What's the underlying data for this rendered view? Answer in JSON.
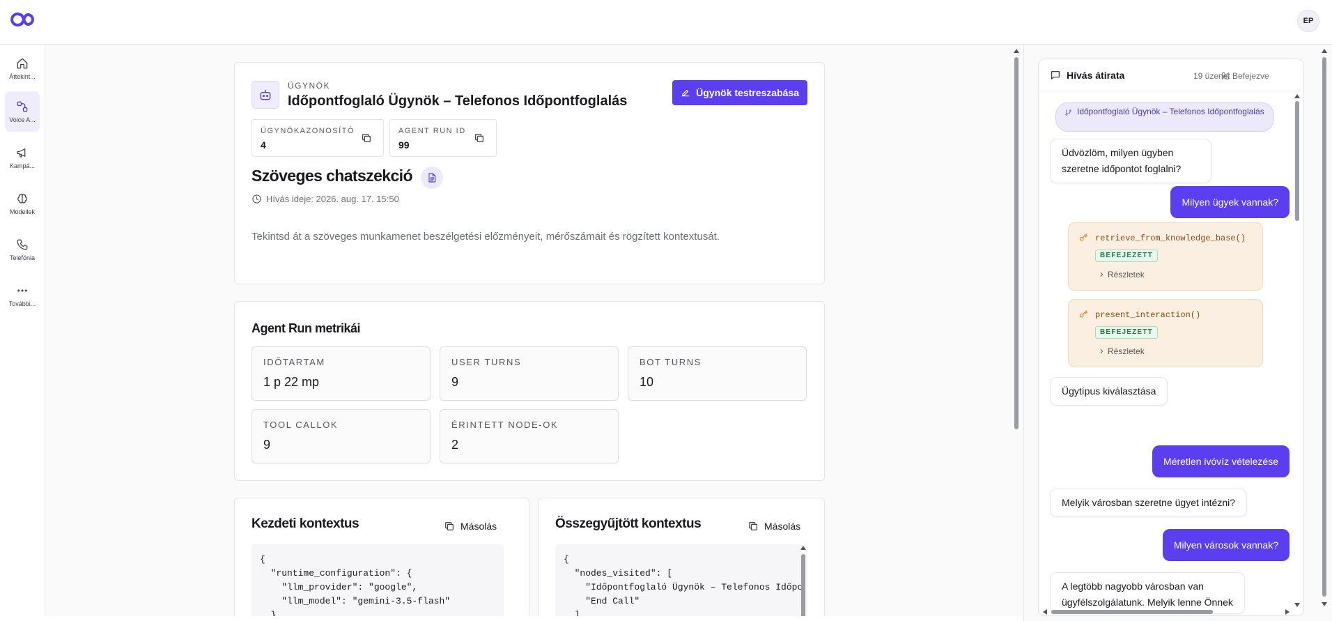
{
  "header": {
    "user_initials": "EP"
  },
  "sidebar": {
    "items": [
      {
        "label": "Áttekint..."
      },
      {
        "label": "Voice A..."
      },
      {
        "label": "Kampá..."
      },
      {
        "label": "Modellek"
      },
      {
        "label": "Telefónia"
      },
      {
        "label": "További..."
      }
    ]
  },
  "agent": {
    "eyebrow": "ÜGYNÖK",
    "name": "Időpontfoglaló Ügynök – Telefonos Időpontfoglalás",
    "customize_label": "Ügynök testreszabása",
    "id_label": "ÜGYNÖKAZONOSÍTÓ",
    "id_value": "4",
    "run_id_label": "AGENT RUN ID",
    "run_id_value": "99"
  },
  "session": {
    "title": "Szöveges chatszekció",
    "call_time": "Hívás ideje: 2026. aug. 17. 15:50",
    "description": "Tekintsd át a szöveges munkamenet beszélgetési előzményeit, mérőszámait és rögzített kontextusát."
  },
  "metrics": {
    "title": "Agent Run metrikái",
    "items": [
      {
        "label": "IDŐTARTAM",
        "value": "1 p 22 mp"
      },
      {
        "label": "USER TURNS",
        "value": "9"
      },
      {
        "label": "BOT TURNS",
        "value": "10"
      },
      {
        "label": "TOOL CALLOK",
        "value": "9"
      },
      {
        "label": "ÉRINTETT NODE-OK",
        "value": "2"
      }
    ]
  },
  "initial_context": {
    "title": "Kezdeti kontextus",
    "copy_label": "Másolás",
    "code": "{\n  \"runtime_configuration\": {\n    \"llm_provider\": \"google\",\n    \"llm_model\": \"gemini-3.5-flash\"\n  },"
  },
  "gathered_context": {
    "title": "Összegyűjtött kontextus",
    "copy_label": "Másolás",
    "code": "{\n  \"nodes_visited\": [\n    \"Időpontfoglaló Ügynök – Telefonos Időpo\n    \"End Call\"\n  ],"
  },
  "transcript": {
    "title": "Hívás átirata",
    "count": "19 üzenet",
    "status": "Befejezve",
    "node_label": "Időpontfoglaló Ügynök – Telefonos Időpontfoglalás",
    "messages": [
      {
        "role": "bot",
        "text": "Üdvözlöm, milyen ügyben szeretne időpontot foglalni?"
      },
      {
        "role": "user",
        "text": "Milyen ügyek vannak?"
      },
      {
        "role": "tool",
        "fn": "retrieve_from_knowledge_base()",
        "status": "BEFEJEZETT",
        "details": "Részletek"
      },
      {
        "role": "tool",
        "fn": "present_interaction()",
        "status": "BEFEJEZETT",
        "details": "Részletek"
      },
      {
        "role": "bot",
        "text": "Ügytípus kiválasztása"
      },
      {
        "role": "user",
        "text": "Méretlen ivóvíz vételezése"
      },
      {
        "role": "bot",
        "text": "Melyik városban szeretne ügyet intézni?"
      },
      {
        "role": "user",
        "text": "Milyen városok vannak?"
      },
      {
        "role": "bot",
        "text": "A legtöbb nagyobb városban van ügyfélszolgálatunk. Melyik lenne Önnek"
      }
    ]
  },
  "colors": {
    "accent": "#5b3ef0",
    "accent_soft": "#ece9fb",
    "tool_bg": "#fbefe2",
    "success": "#227a3e"
  }
}
